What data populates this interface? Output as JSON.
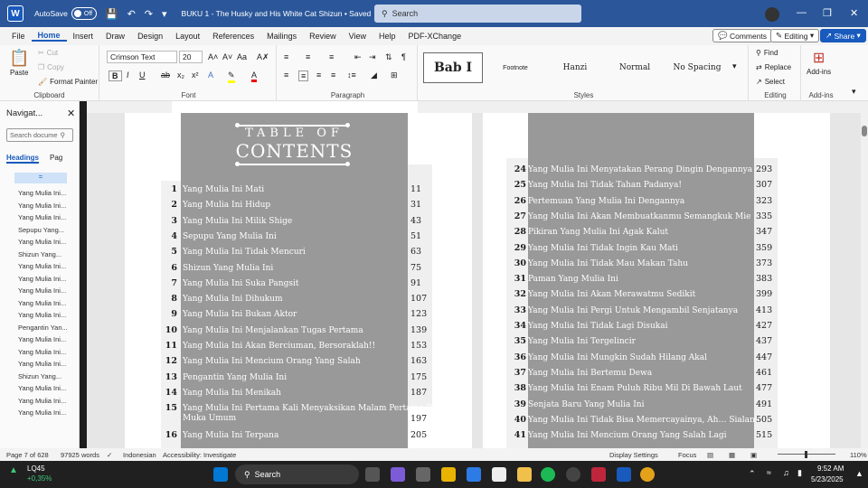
{
  "titlebar": {
    "autosave": "AutoSave",
    "toggle": "Off",
    "doc_title": "BUKU 1 - The Husky and His White Cat Shizun • Saved",
    "search": "Search"
  },
  "tabs": [
    "File",
    "Home",
    "Insert",
    "Draw",
    "Design",
    "Layout",
    "References",
    "Mailings",
    "Review",
    "View",
    "Help",
    "PDF-XChange"
  ],
  "tabs_right": {
    "comments": "Comments",
    "editing": "Editing",
    "share": "Share"
  },
  "clipboard": {
    "paste": "Paste",
    "cut": "Cut",
    "copy": "Copy",
    "format_painter": "Format Painter",
    "label": "Clipboard"
  },
  "font": {
    "name": "Crimson Text",
    "size": "20",
    "label": "Font"
  },
  "paragraph": {
    "label": "Paragraph"
  },
  "styles": {
    "items": [
      "Bab I",
      "Footnote",
      "Hanzi",
      "Normal",
      "No Spacing"
    ],
    "label": "Styles"
  },
  "editing": {
    "find": "Find",
    "replace": "Replace",
    "select": "Select",
    "label": "Editing"
  },
  "addins": {
    "btn": "Add-ins",
    "label": "Add-ins"
  },
  "nav": {
    "title": "Navigat...",
    "search_placeholder": "Search docume",
    "tab_headings": "Headings",
    "tab_pages": "Pag",
    "selected": "=",
    "items": [
      "Yang Mulia Ini...",
      "Yang Mulia Ini...",
      "Yang Mulia Ini...",
      "Sepupu Yang...",
      "Yang Mulia Ini...",
      "Shizun Yang...",
      "Yang Mulia Ini...",
      "Yang Mulia Ini...",
      "Yang Mulia Ini...",
      "Yang Mulia Ini...",
      "Yang Mulia Ini...",
      "Pengantin Yan...",
      "Yang Mulia Ini...",
      "Yang Mulia Ini...",
      "Yang Mulia Ini...",
      "Shizun Yang...",
      "Yang Mulia Ini...",
      "Yang Mulia Ini...",
      "Yang Mulia Ini..."
    ]
  },
  "toc": {
    "heading1": "TABLE OF",
    "heading2": "CONTENTS",
    "left": [
      {
        "n": "1",
        "t": "Yang Mulia Ini Mati",
        "p": "11"
      },
      {
        "n": "2",
        "t": "Yang Mulia Ini Hidup",
        "p": "31"
      },
      {
        "n": "3",
        "t": "Yang Mulia Ini Milik Shige",
        "p": "43"
      },
      {
        "n": "4",
        "t": "Sepupu Yang Mulia Ini",
        "p": "51"
      },
      {
        "n": "5",
        "t": "Yang Mulia Ini Tidak Mencuri",
        "p": "63"
      },
      {
        "n": "6",
        "t": "Shizun Yang Mulia Ini",
        "p": "75"
      },
      {
        "n": "7",
        "t": "Yang Mulia Ini Suka Pangsit",
        "p": "91"
      },
      {
        "n": "8",
        "t": "Yang Mulia Ini Dihukum",
        "p": "107"
      },
      {
        "n": "9",
        "t": "Yang Mulia Ini Bukan Aktor",
        "p": "123"
      },
      {
        "n": "10",
        "t": "Yang Mulia Ini Menjalankan Tugas Pertama",
        "p": "139"
      },
      {
        "n": "11",
        "t": "Yang Mulia Ini Akan Berciuman, Bersoraklah!!",
        "p": "153"
      },
      {
        "n": "12",
        "t": "Yang Mulia Ini Mencium Orang Yang Salah",
        "p": "163"
      },
      {
        "n": "13",
        "t": "Pengantin Yang Mulia Ini",
        "p": "175"
      },
      {
        "n": "14",
        "t": "Yang Mulia Ini Menikah",
        "p": "187"
      },
      {
        "n": "15",
        "t": "Yang Mulia Ini Pertama Kali Menyaksikan Malam Pertama Di",
        "t2": "Muka Umum",
        "p": "197"
      },
      {
        "n": "16",
        "t": "Yang Mulia Ini Terpana",
        "p": "205"
      }
    ],
    "right": [
      {
        "n": "24",
        "t": "Yang Mulia Ini Menyatakan Perang Dingin Dengannya",
        "p": "293"
      },
      {
        "n": "25",
        "t": "Yang Mulia Ini Tidak Tahan Padanya!",
        "p": "307"
      },
      {
        "n": "26",
        "t": "Pertemuan Yang Mulia Ini Dengannya",
        "p": "323"
      },
      {
        "n": "27",
        "t": "Yang Mulia Ini Akan Membuatkanmu Semangkuk Mie",
        "p": "335"
      },
      {
        "n": "28",
        "t": "Pikiran Yang Mulia Ini Agak Kalut",
        "p": "347"
      },
      {
        "n": "29",
        "t": "Yang Mulia Ini Tidak Ingin Kau Mati",
        "p": "359"
      },
      {
        "n": "30",
        "t": "Yang Mulia Ini Tidak Mau Makan Tahu",
        "p": "373"
      },
      {
        "n": "31",
        "t": "Paman Yang Mulia Ini",
        "p": "383"
      },
      {
        "n": "32",
        "t": "Yang Mulia Ini Akan Merawatmu Sedikit",
        "p": "399"
      },
      {
        "n": "33",
        "t": "Yang Mulia Ini Pergi Untuk Mengambil Senjatanya",
        "p": "413"
      },
      {
        "n": "34",
        "t": "Yang Mulia Ini Tidak Lagi Disukai",
        "p": "427"
      },
      {
        "n": "35",
        "t": "Yang Mulia Ini Tergelincir",
        "p": "437"
      },
      {
        "n": "36",
        "t": "Yang Mulia Ini Mungkin Sudah Hilang Akal",
        "p": "447"
      },
      {
        "n": "37",
        "t": "Yang Mulia Ini Bertemu Dewa",
        "p": "461"
      },
      {
        "n": "38",
        "t": "Yang Mulia Ini Enam Puluh Ribu Mil Di Bawah Laut",
        "p": "477"
      },
      {
        "n": "39",
        "t": "Senjata Baru Yang Mulia Ini",
        "p": "491"
      },
      {
        "n": "40",
        "t": "Yang Mulia Ini Tidak Bisa Memercayainya, Ah… Sialan!!",
        "p": "505"
      },
      {
        "n": "41",
        "t": "Yang Mulia Ini Mencium Orang Yang Salah Lagi",
        "p": "515"
      }
    ]
  },
  "status": {
    "page": "Page 7 of 628",
    "words": "97925 words",
    "lang": "Indonesian",
    "access": "Accessibility: Investigate",
    "display": "Display Settings",
    "focus": "Focus",
    "zoom": "110%"
  },
  "taskbar": {
    "stock": "LQ45",
    "stock_change": "+0,35%",
    "search": "Search",
    "time": "9:52 AM",
    "date": "5/23/2025"
  }
}
